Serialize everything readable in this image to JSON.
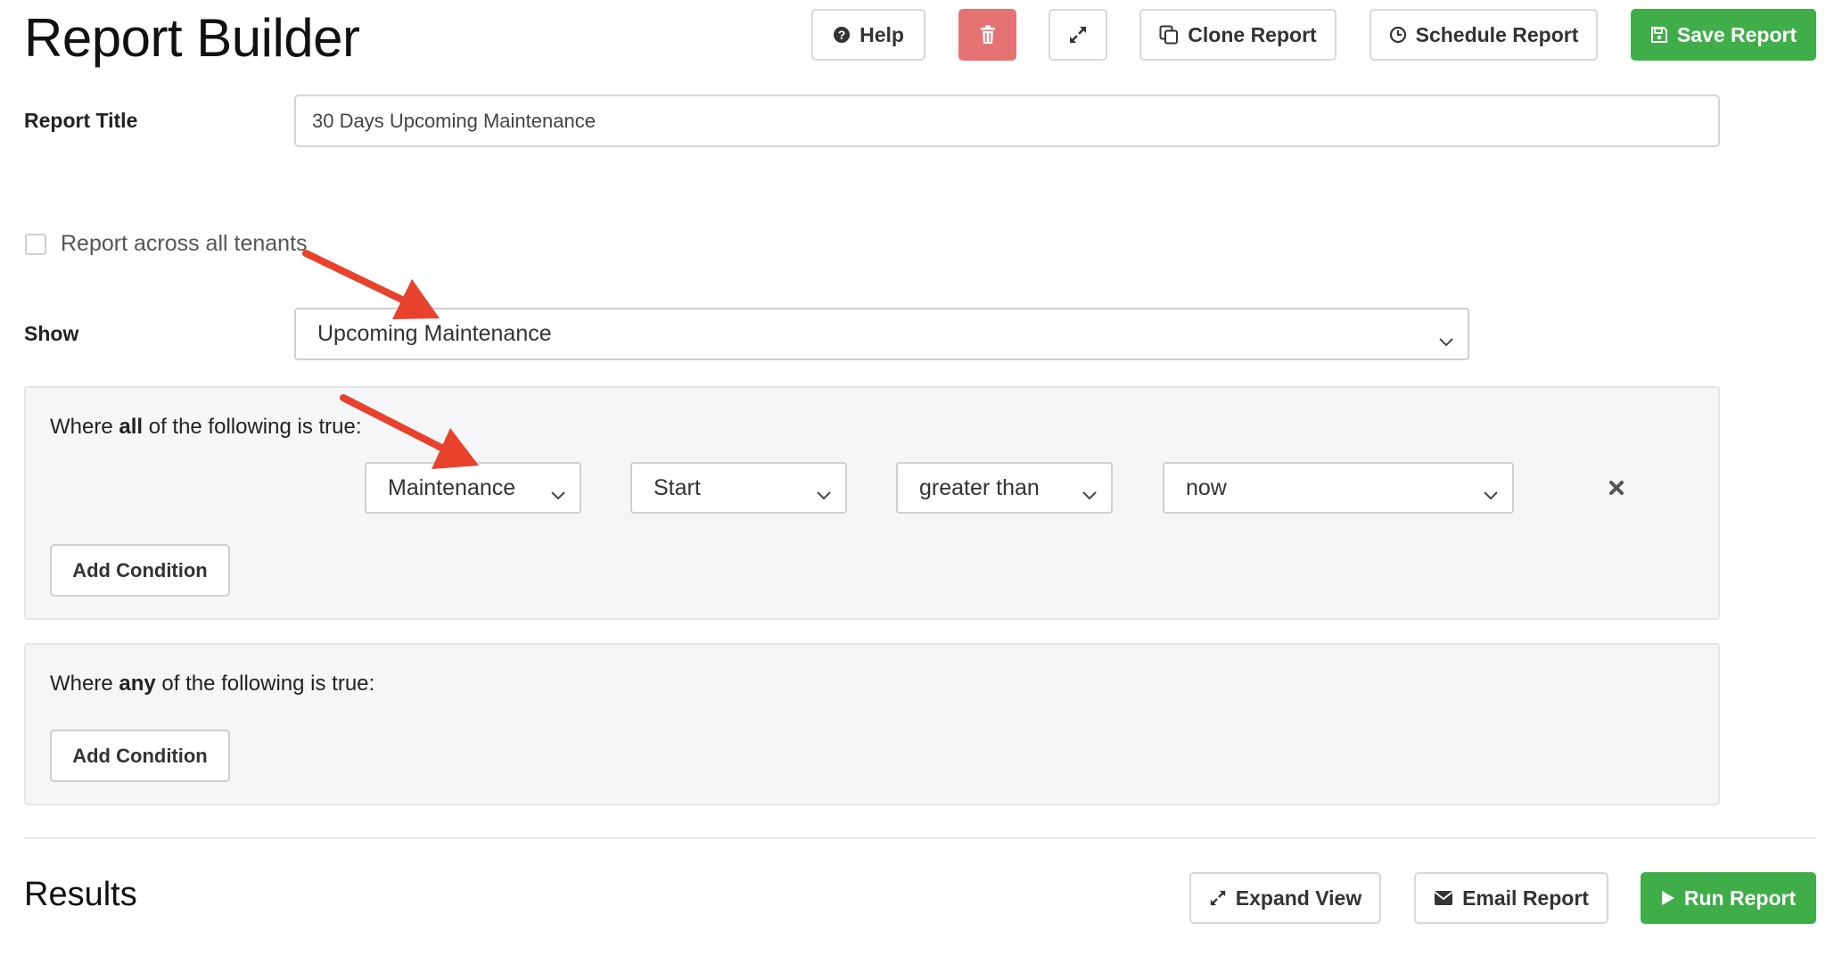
{
  "header": {
    "title": "Report Builder",
    "buttons": {
      "help": "Help",
      "clone": "Clone Report",
      "schedule": "Schedule Report",
      "save": "Save Report"
    }
  },
  "form": {
    "report_title_label": "Report Title",
    "report_title_value": "30 Days Upcoming Maintenance",
    "all_tenants_label": "Report across all tenants",
    "all_tenants_checked": false,
    "show_label": "Show",
    "show_value": "Upcoming Maintenance"
  },
  "all_group": {
    "prefix": "Where ",
    "keyword": "all",
    "suffix": " of the following is true:",
    "condition": {
      "field": "Maintenance",
      "attribute": "Start",
      "operator": "greater than",
      "value": "now"
    },
    "add_label": "Add Condition"
  },
  "any_group": {
    "prefix": "Where ",
    "keyword": "any",
    "suffix": " of the following is true:",
    "add_label": "Add Condition"
  },
  "results": {
    "title": "Results",
    "buttons": {
      "expand": "Expand View",
      "email": "Email Report",
      "run": "Run Report"
    }
  },
  "colors": {
    "primary_green": "#3fae49",
    "danger_red": "#e57373",
    "annotation_arrow": "#e8412c"
  }
}
